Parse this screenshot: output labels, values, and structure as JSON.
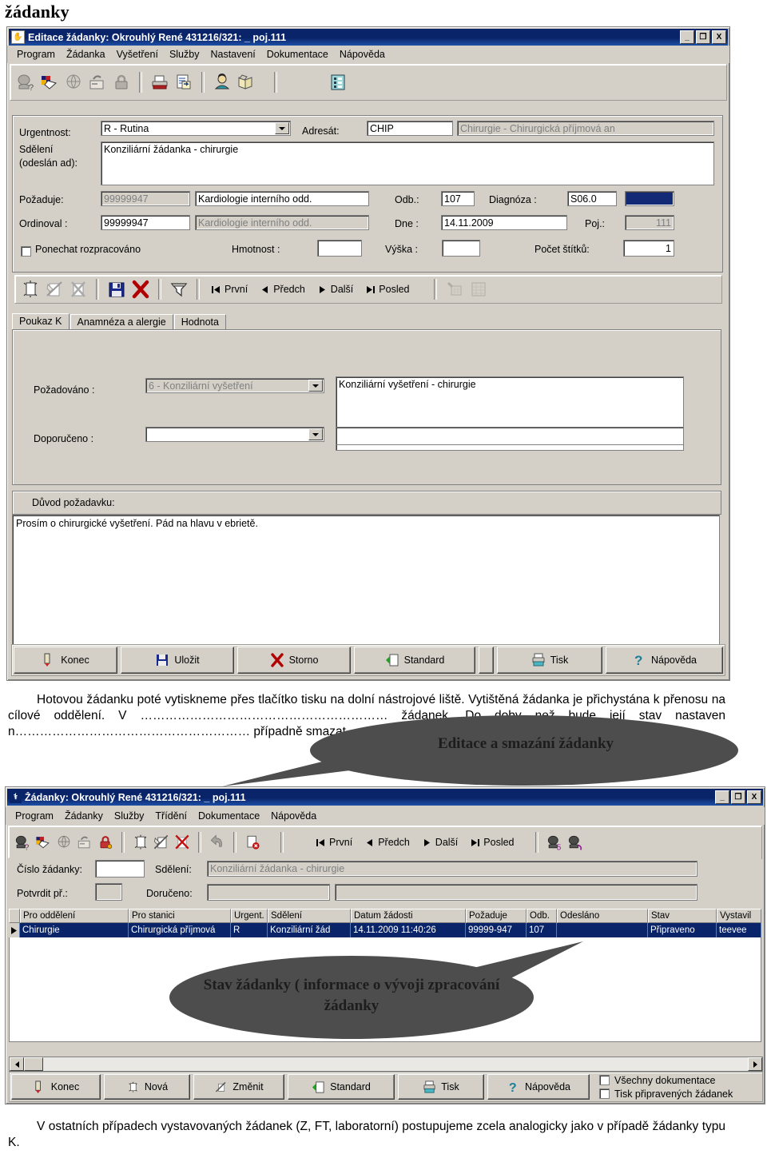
{
  "document": {
    "heading": "žádanky",
    "paragraph1": "Hotovou žádanku poté vytiskneme přes tlačítko tisku na dolní nástrojové liště. Vytištěná žádanka je přichystána k přenosu na cílové oddělení. V …………………………………………………… žádanek. Do doby než bude její stav nastaven n………………………………………………… případně smazat.",
    "paragraph2": "V ostatních případech vystavovaných žádanek (Z, FT, laboratorní) postupujeme zcela analogicky jako v případě žádanky typu K."
  },
  "callouts": {
    "edit_delete": "Editace a smazání žádanky",
    "status": "Stav žádanky ( informace o vývoji zpracování žádanky"
  },
  "window_edit": {
    "title": "Editace žádanky: Okrouhlý René 431216/321: _ poj.111",
    "title_icon": "app-icon",
    "window_buttons": {
      "minimize": "_",
      "maximize": "❐",
      "close": "X"
    },
    "menu": [
      "Program",
      "Žádanka",
      "Vyšetření",
      "Služby",
      "Nastavení",
      "Dokumentace",
      "Nápověda"
    ],
    "toolbar_icons": [
      "patient-query-icon",
      "cards-icon",
      "globe-info-icon",
      "export-icon",
      "lock-icon",
      "print-icon",
      "document-arrow-icon",
      "person-icon",
      "book-icon",
      "list-view-icon"
    ],
    "form": {
      "urgentnost_label": "Urgentnost:",
      "urgentnost_value": "R - Rutina",
      "adresat_label": "Adresát:",
      "adresat_code": "CHIP",
      "adresat_desc": "Chirurgie - Chirurgická příjmová an",
      "sdeleni_label_line1": "Sdělení",
      "sdeleni_label_line2": "(odeslán ad):",
      "sdeleni_value": "Konziliární žádanka - chirurgie",
      "pozaduje_label": "Požaduje:",
      "pozaduje_code": "99999947",
      "pozaduje_desc": "Kardiologie  interního odd.",
      "ordinoval_label": "Ordinoval :",
      "ordinoval_code": "99999947",
      "ordinoval_desc": "Kardiologie  interního odd.",
      "odb_label": "Odb.:",
      "odb_value": "107",
      "diagnoza_label": "Diagnóza :",
      "diagnoza_value": "S06.0",
      "diagnoza_swatch_color": "#122a75",
      "dne_label": "Dne :",
      "dne_value": "14.11.2009",
      "poj_label": "Poj.:",
      "poj_value": "111",
      "ponechat_label": "Ponechat rozpracováno",
      "hmotnost_label": "Hmotnost :",
      "hmotnost_value": "",
      "vyska_label": "Výška :",
      "vyska_value": "",
      "pocet_stitku_label": "Počet štítků:",
      "pocet_stitku_value": "1"
    },
    "rec_toolbar": {
      "icons": [
        "new-record-icon",
        "edit-record-icon",
        "delete-record-icon",
        "save-icon",
        "cancel-icon",
        "filter-icon",
        "grid-icon",
        "table-icon"
      ],
      "nav": [
        {
          "label": "První",
          "glyph": "prev-first-icon"
        },
        {
          "label": "Předch",
          "glyph": "prev-icon"
        },
        {
          "label": "Další",
          "glyph": "next-icon"
        },
        {
          "label": "Posled",
          "glyph": "next-last-icon"
        }
      ]
    },
    "tabs": [
      {
        "label": "Poukaz K",
        "selected": true
      },
      {
        "label": "Anamnéza a alergie",
        "selected": false
      },
      {
        "label": "Hodnota",
        "selected": false
      }
    ],
    "poukaz": {
      "pozadovano_label": "Požadováno :",
      "pozadovano_value": "6 - Konziliární vyšetření",
      "pozadovano_text": "Konziliární vyšetření - chirurgie",
      "doporuceno_label": "Doporučeno :",
      "doporuceno_value": "",
      "doporuceno_text": ""
    },
    "duvod": {
      "label": "Důvod požadavku:",
      "text": "Prosím o chirurgické vyšetření. Pád na hlavu v ebrietě."
    },
    "buttons": [
      {
        "label": "Konec",
        "icon": "exit-icon"
      },
      {
        "label": "Uložit",
        "icon": "save-icon"
      },
      {
        "label": "Storno",
        "icon": "cancel-icon"
      },
      {
        "label": "Standard",
        "icon": "standard-icon"
      },
      {
        "label": "Tisk",
        "icon": "print-icon"
      },
      {
        "label": "Nápověda",
        "icon": "help-icon"
      }
    ]
  },
  "window_list": {
    "title": "Žádanky: Okrouhlý René 431216/321: _ poj.111",
    "title_icon": "app-icon",
    "window_buttons": {
      "minimize": "_",
      "maximize": "❐",
      "close": "X"
    },
    "menu": [
      "Program",
      "Žádanky",
      "Služby",
      "Třídění",
      "Dokumentace",
      "Nápověda"
    ],
    "toolbar_icons": [
      "patient-query-icon",
      "cards-icon",
      "globe-info-icon",
      "export-icon",
      "unlock-icon",
      "new-record-icon",
      "edit-record-icon",
      "delete-record-icon",
      "undo-icon",
      "document-cancel-icon",
      "person-search-icon",
      "person-refresh-icon"
    ],
    "nav": [
      {
        "label": "První",
        "glyph": "prev-first-icon"
      },
      {
        "label": "Předch",
        "glyph": "prev-icon"
      },
      {
        "label": "Další",
        "glyph": "next-icon"
      },
      {
        "label": "Posled",
        "glyph": "next-last-icon"
      }
    ],
    "filter": {
      "cislo_label": "Číslo žádanky:",
      "cislo_value": "",
      "sdeleni_label": "Sdělení:",
      "sdeleni_value": "Konziliární žádanka - chirurgie",
      "potvrdit_label": "Potvrdit př.:",
      "potvrdit_value": "",
      "doruceno_label": "Doručeno:",
      "doruceno_value": "",
      "doruceno_value2": ""
    },
    "grid": {
      "columns": [
        "Pro oddělení",
        "Pro stanici",
        "Urgent.",
        "Sdělení",
        "Datum žádosti",
        "Požaduje",
        "Odb.",
        "Odesláno",
        "Stav",
        "Vystavil"
      ],
      "rows": [
        [
          "Chirurgie",
          "Chirurgická příjmová",
          "R",
          "Konziliární žád",
          "14.11.2009 11:40:26",
          "99999-947",
          "107",
          "",
          "Připraveno",
          "teevee"
        ]
      ]
    },
    "buttons": [
      {
        "label": "Konec",
        "icon": "exit-icon"
      },
      {
        "label": "Nová",
        "icon": "new-record-icon"
      },
      {
        "label": "Změnit",
        "icon": "edit-record-icon"
      },
      {
        "label": "Standard",
        "icon": "standard-icon"
      },
      {
        "label": "Tisk",
        "icon": "print-icon"
      },
      {
        "label": "Nápověda",
        "icon": "help-icon"
      }
    ],
    "checkboxes": [
      {
        "label": "Všechny dokumentace",
        "checked": false
      },
      {
        "label": "Tisk připravených žádanek",
        "checked": false
      }
    ]
  }
}
